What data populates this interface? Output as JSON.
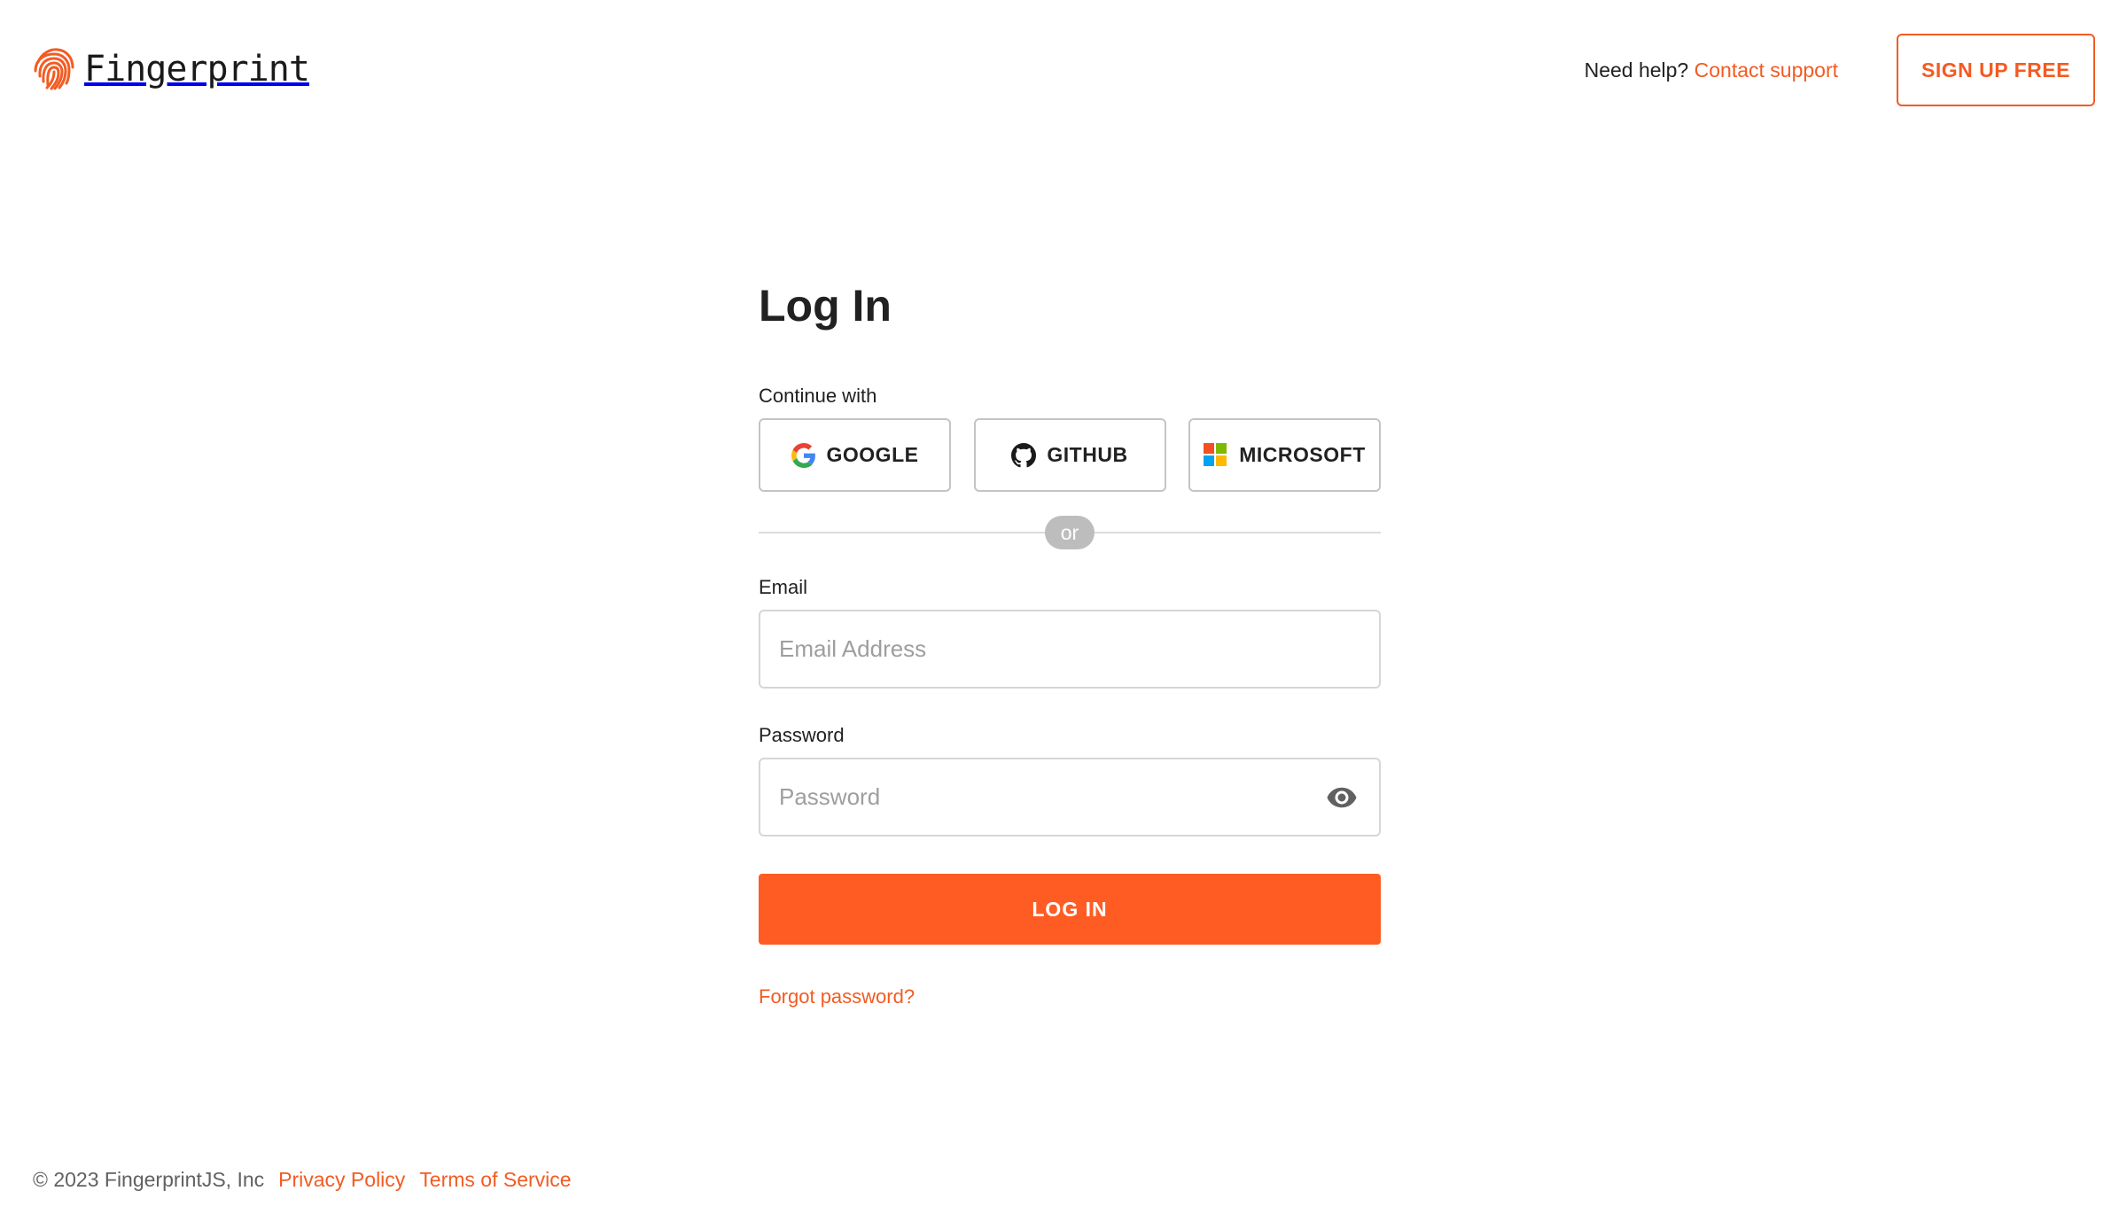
{
  "brand": {
    "name": "Fingerprint",
    "logo_icon": "fingerprint-icon",
    "accent": "#f35b22"
  },
  "header": {
    "help_text": "Need help?",
    "contact_link": "Contact support",
    "signup_label": "SIGN UP FREE"
  },
  "login": {
    "title": "Log In",
    "continue_with": "Continue with",
    "providers": [
      {
        "label": "GOOGLE",
        "icon": "google-icon"
      },
      {
        "label": "GITHUB",
        "icon": "github-icon"
      },
      {
        "label": "MICROSOFT",
        "icon": "microsoft-icon"
      }
    ],
    "divider_text": "or",
    "email": {
      "label": "Email",
      "placeholder": "Email Address",
      "value": ""
    },
    "password": {
      "label": "Password",
      "placeholder": "Password",
      "value": "",
      "toggle_icon": "eye-icon"
    },
    "submit_label": "LOG IN",
    "forgot_link": "Forgot password?",
    "button_color": "#ff5c24"
  },
  "footer": {
    "copyright": "© 2023 FingerprintJS, Inc",
    "privacy": "Privacy Policy",
    "terms": "Terms of Service"
  }
}
